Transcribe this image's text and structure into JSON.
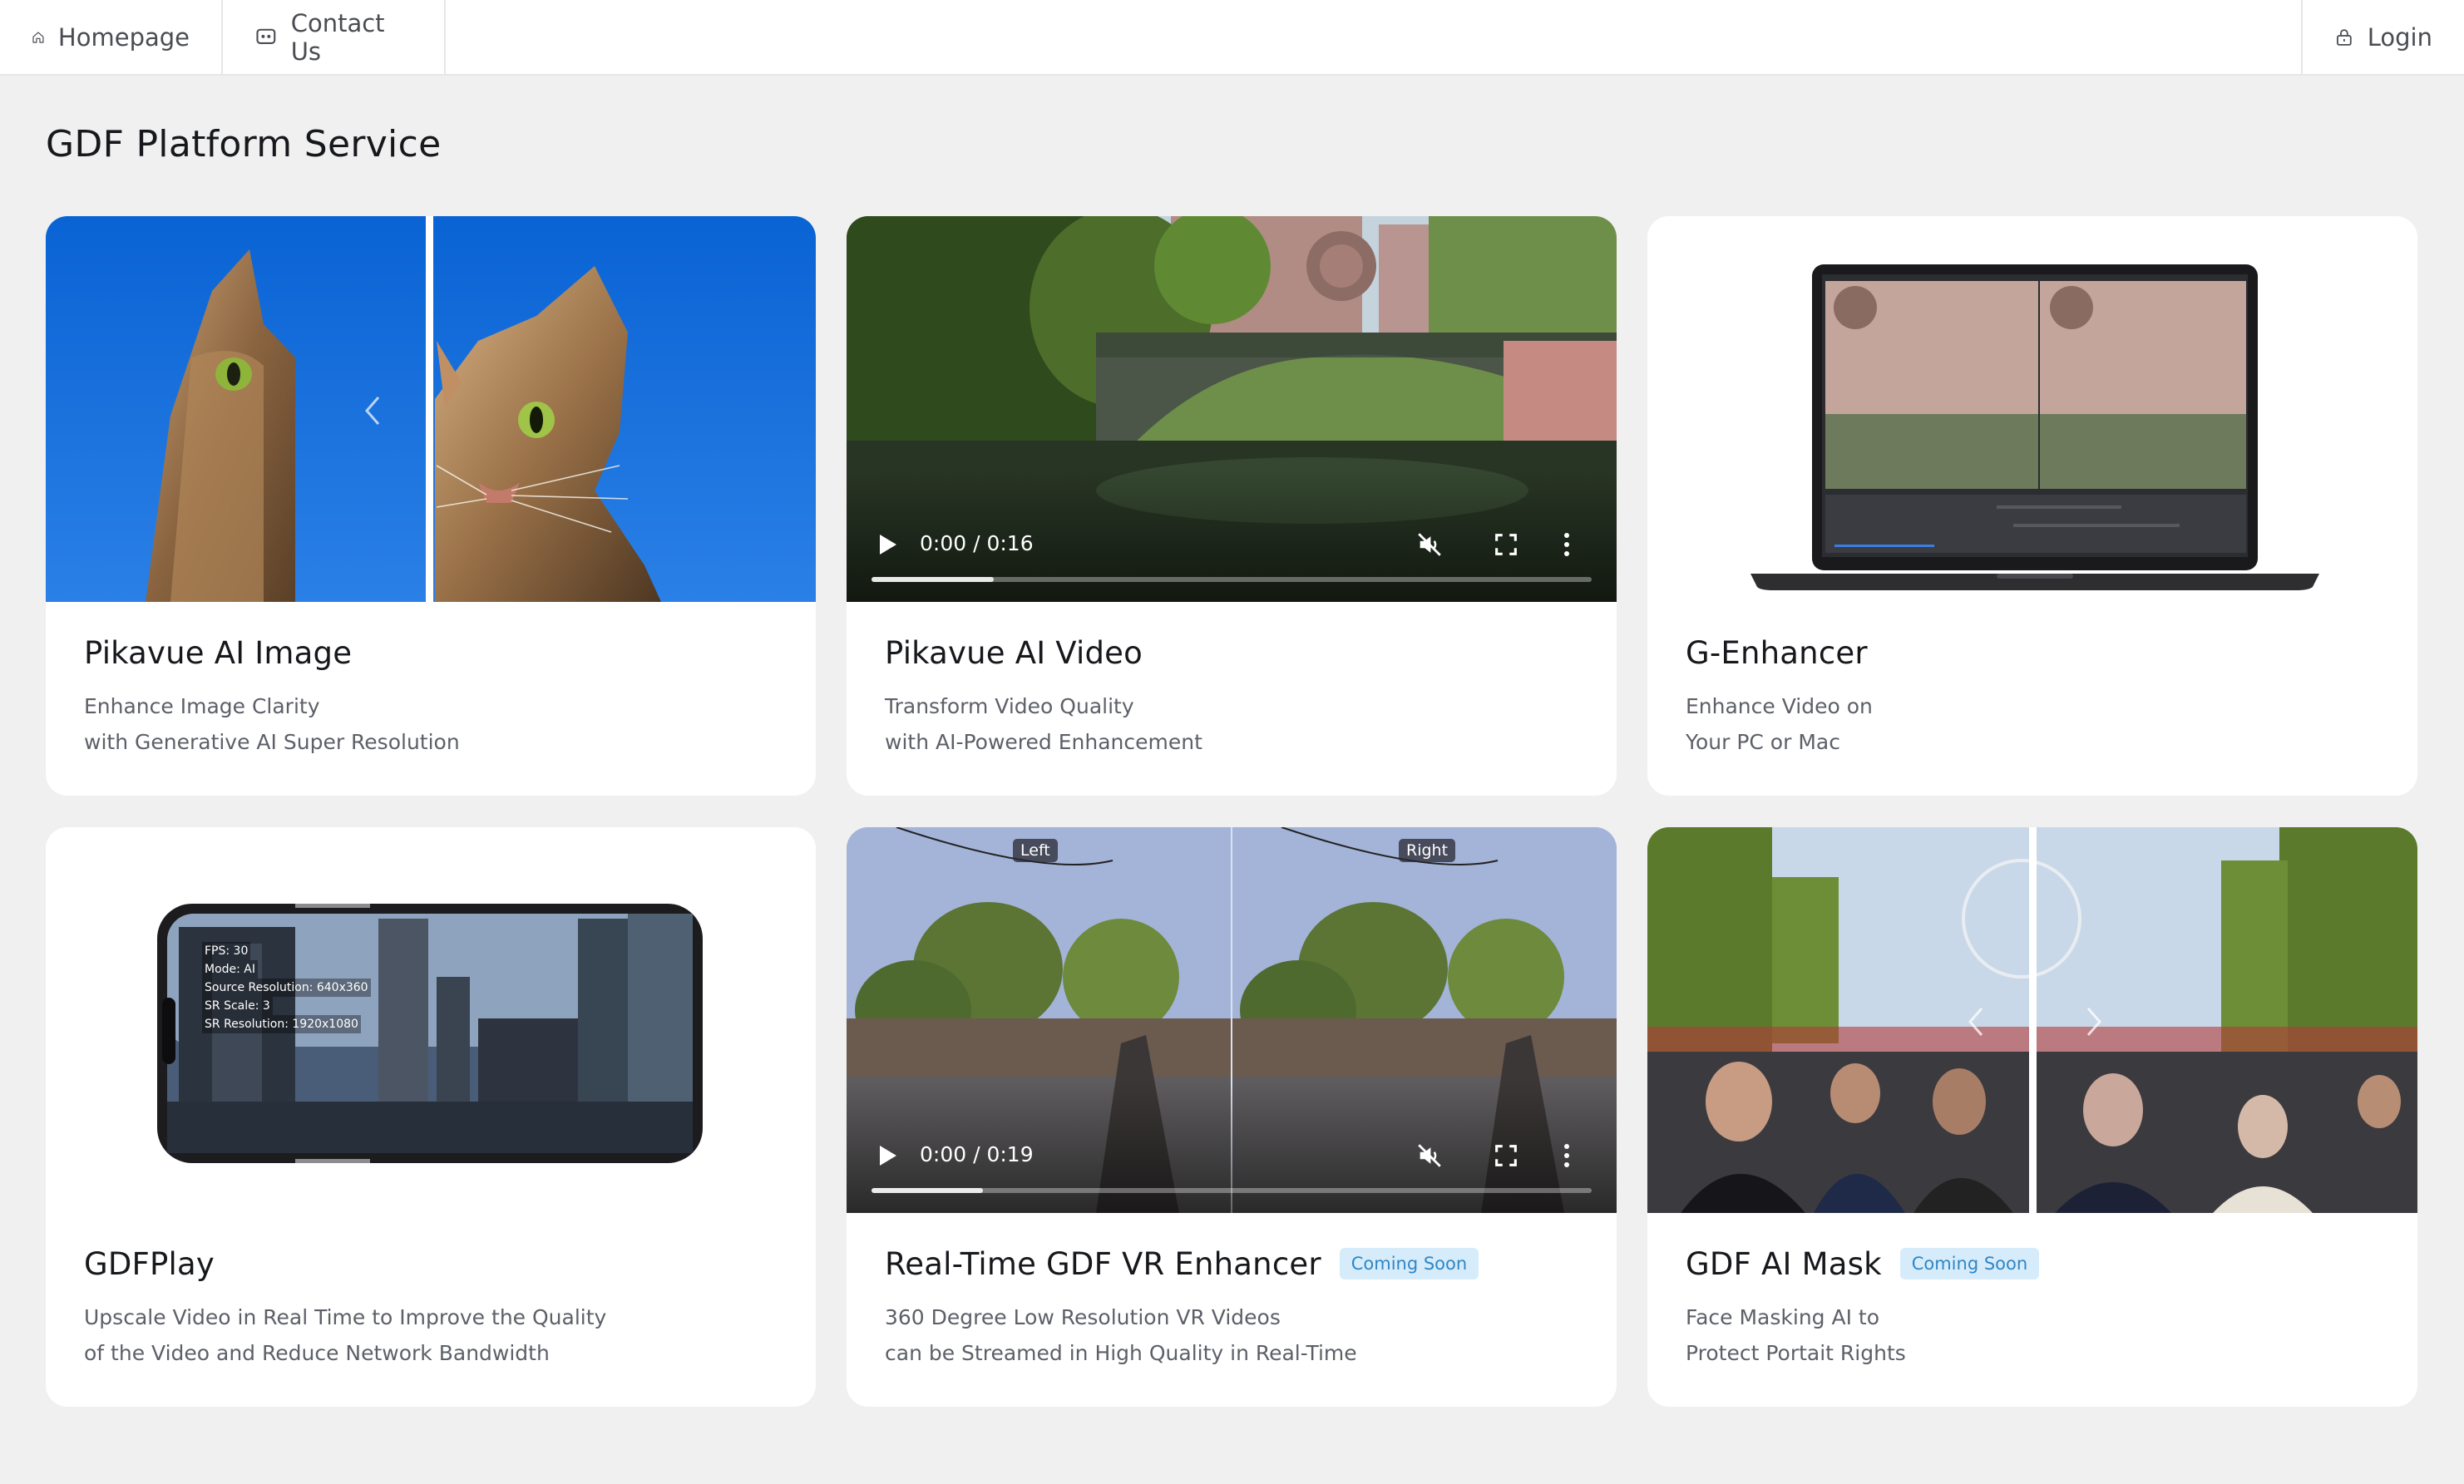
{
  "nav": {
    "home_label": "Homepage",
    "contact_label": "Contact Us",
    "login_label": "Login"
  },
  "page_title": "GDF Platform Service",
  "cards": [
    {
      "title": "Pikavue AI Image",
      "desc_line1": "Enhance Image Clarity",
      "desc_line2": "with Generative AI Super Resolution"
    },
    {
      "title": "Pikavue AI Video",
      "desc_line1": "Transform Video Quality",
      "desc_line2": "with AI-Powered Enhancement",
      "video_time": "0:00 / 0:16",
      "progress": 0.17
    },
    {
      "title": "G-Enhancer",
      "desc_line1": "Enhance Video on",
      "desc_line2": "Your PC or Mac"
    },
    {
      "title": "GDFPlay",
      "desc_line1": "Upscale Video in Real Time to Improve the Quality",
      "desc_line2": "of the Video and Reduce Network Bandwidth",
      "overlay": {
        "fps": "FPS: 30",
        "mode": "Mode: AI",
        "source": "Source Resolution: 640x360",
        "scale": "SR Scale: 3",
        "sr_res": "SR Resolution: 1920x1080"
      }
    },
    {
      "title": "Real-Time GDF VR Enhancer",
      "badge": "Coming Soon",
      "desc_line1": "360 Degree Low Resolution VR Videos",
      "desc_line2": "can be Streamed in High Quality in Real-Time",
      "video_time": "0:00 / 0:19",
      "progress": 0.155,
      "left_tag": "Left",
      "right_tag": "Right"
    },
    {
      "title": "GDF AI Mask",
      "badge": "Coming Soon",
      "desc_line1": "Face Masking AI to",
      "desc_line2": "Protect Portait Rights"
    }
  ],
  "colors": {
    "background": "#f0f0f0",
    "card": "#ffffff",
    "badge_bg": "#d6ecfb",
    "badge_text": "#2f86c6",
    "sky_blue": "#1a6fd6"
  },
  "icons": [
    "home-icon",
    "chat-icon",
    "lock-icon",
    "play-icon",
    "mute-icon",
    "fullscreen-icon",
    "more-vertical-icon",
    "chevron-left-icon",
    "chevron-right-icon"
  ]
}
